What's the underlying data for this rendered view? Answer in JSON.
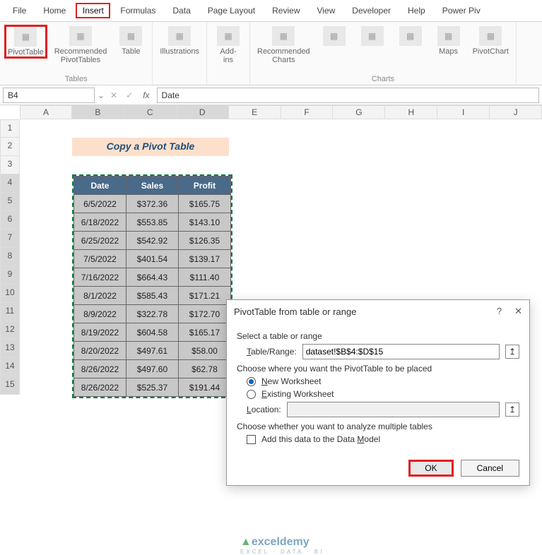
{
  "menu": [
    "File",
    "Home",
    "Insert",
    "Formulas",
    "Data",
    "Page Layout",
    "Review",
    "View",
    "Developer",
    "Help",
    "Power Piv"
  ],
  "activeMenuIndex": 2,
  "ribbon": {
    "groups": [
      {
        "name": "Tables",
        "items": [
          {
            "label": "PivotTable",
            "hl": true
          },
          {
            "label": "Recommended\nPivotTables"
          },
          {
            "label": "Table"
          }
        ]
      },
      {
        "name": "",
        "items": [
          {
            "label": "Illustrations"
          }
        ]
      },
      {
        "name": "",
        "items": [
          {
            "label": "Add-\nins"
          }
        ]
      },
      {
        "name": "Charts",
        "items": [
          {
            "label": "Recommended\nCharts"
          },
          {
            "label": ""
          },
          {
            "label": ""
          },
          {
            "label": ""
          },
          {
            "label": "Maps"
          },
          {
            "label": "PivotChart"
          }
        ]
      }
    ]
  },
  "namebox": "B4",
  "formula": "Date",
  "columns": [
    "A",
    "B",
    "C",
    "D",
    "E",
    "F",
    "G",
    "H",
    "I",
    "J"
  ],
  "selectedCols": [
    1,
    2,
    3
  ],
  "rowCount": 15,
  "selectedRowsFrom": 4,
  "titleBanner": "Copy a Pivot Table",
  "table": {
    "headers": [
      "Date",
      "Sales",
      "Profit"
    ],
    "rows": [
      [
        "6/5/2022",
        "$372.36",
        "$165.75"
      ],
      [
        "6/18/2022",
        "$553.85",
        "$143.10"
      ],
      [
        "6/25/2022",
        "$542.92",
        "$126.35"
      ],
      [
        "7/5/2022",
        "$401.54",
        "$139.17"
      ],
      [
        "7/16/2022",
        "$664.43",
        "$111.40"
      ],
      [
        "8/1/2022",
        "$585.43",
        "$171.21"
      ],
      [
        "8/9/2022",
        "$322.78",
        "$172.70"
      ],
      [
        "8/19/2022",
        "$604.58",
        "$165.17"
      ],
      [
        "8/20/2022",
        "$497.61",
        "$58.00"
      ],
      [
        "8/26/2022",
        "$497.60",
        "$62.78"
      ],
      [
        "8/26/2022",
        "$525.37",
        "$191.44"
      ]
    ]
  },
  "dialog": {
    "title": "PivotTable from table or range",
    "sec1": "Select a table or range",
    "rangeLabel": "Table/Range:",
    "rangeValue": "dataset!$B$4:$D$15",
    "sec2": "Choose where you want the PivotTable to be placed",
    "optNew": "New Worksheet",
    "optExisting": "Existing Worksheet",
    "locLabel": "Location:",
    "locValue": "",
    "sec3": "Choose whether you want to analyze multiple tables",
    "chkLabel": "Add this data to the Data Model",
    "ok": "OK",
    "cancel": "Cancel"
  },
  "watermark": {
    "main": "exceldemy",
    "sub": "EXCEL · DATA · BI"
  }
}
